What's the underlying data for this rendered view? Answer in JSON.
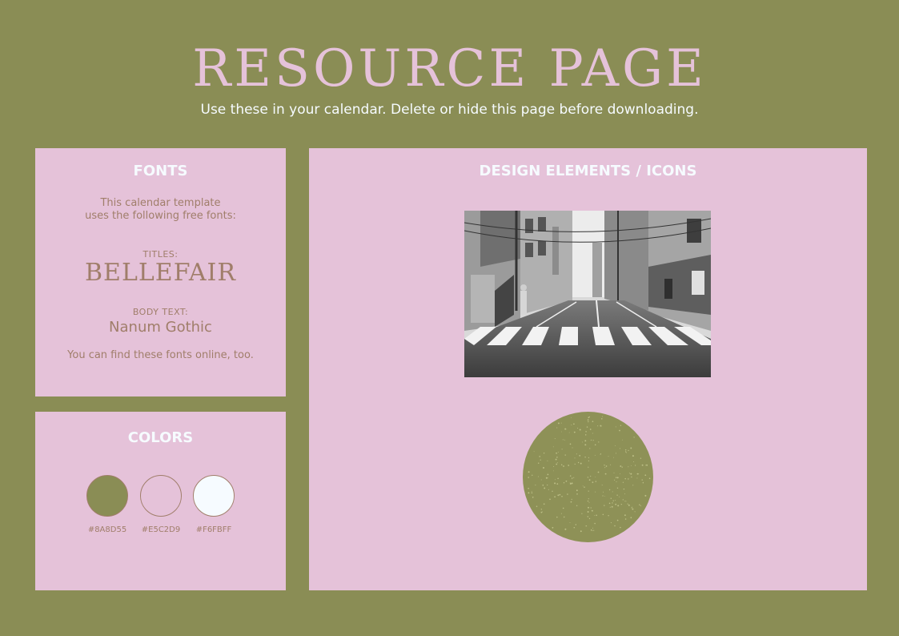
{
  "header": {
    "title": "RESOURCE PAGE",
    "subtitle": "Use these in your calendar. Delete or hide this page before downloading."
  },
  "fonts_panel": {
    "heading": "FONTS",
    "intro_line1": "This calendar template",
    "intro_line2": "uses the following free fonts:",
    "titles_label": "TITLES:",
    "titles_font": "BELLEFAIR",
    "body_label": "BODY TEXT:",
    "body_font": "Nanum Gothic",
    "footer_note": "You can find these fonts online, too."
  },
  "colors_panel": {
    "heading": "COLORS",
    "swatches": [
      {
        "hex": "#8A8D55",
        "label": "#8A8D55"
      },
      {
        "hex": "#E5C2D9",
        "label": "#E5C2D9"
      },
      {
        "hex": "#F6FBFF",
        "label": "#F6FBFF"
      }
    ]
  },
  "design_panel": {
    "heading": "DESIGN ELEMENTS / ICONS",
    "photo_icon": "street-crosswalk-photo",
    "texture_icon": "speckled-olive-circle"
  },
  "colors": {
    "background": "#8A8D55",
    "panel": "#E5C2D9",
    "heading_text": "#F6FBFF",
    "body_text": "#A07E6A"
  }
}
